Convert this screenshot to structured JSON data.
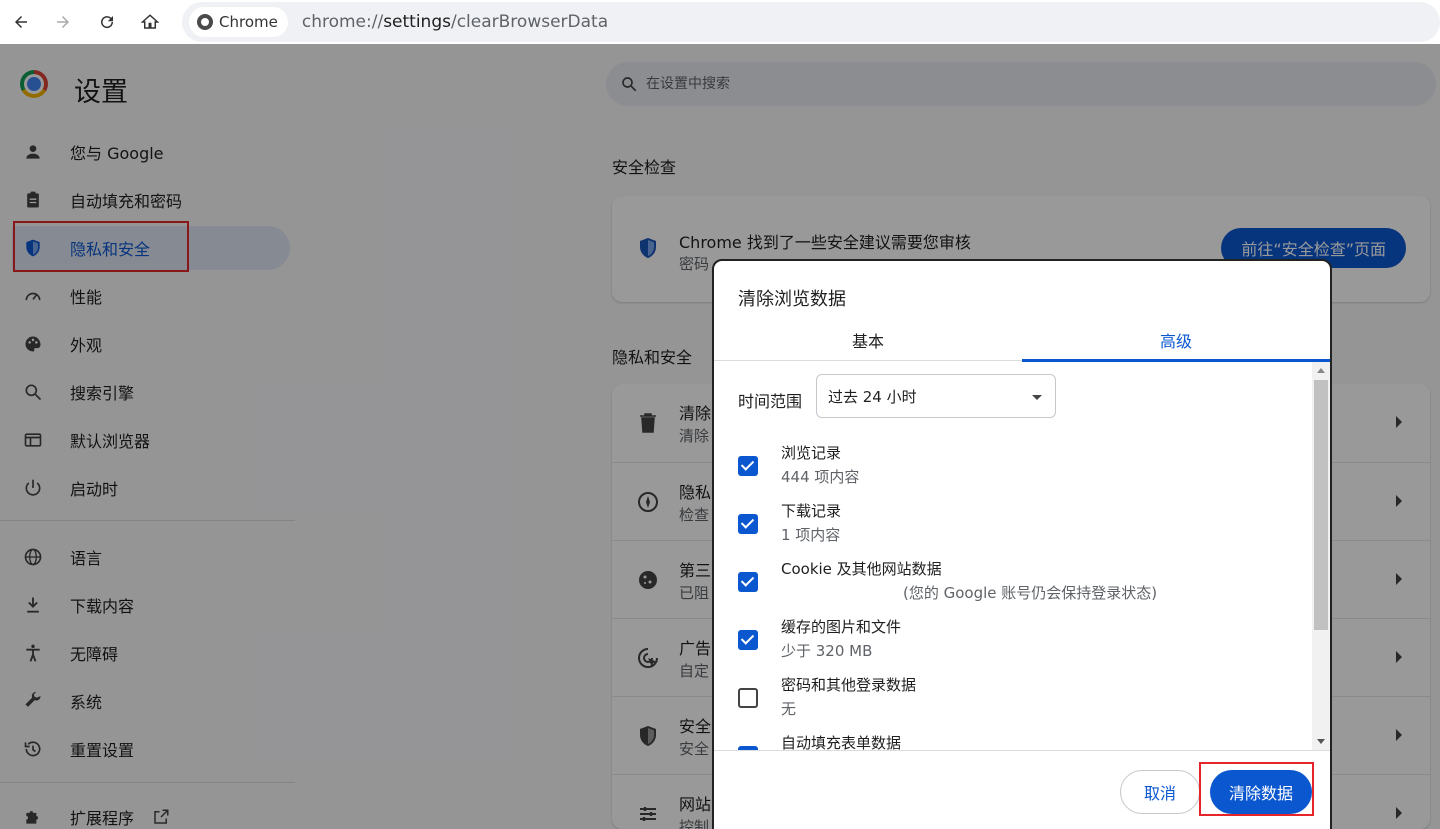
{
  "browser": {
    "chip_label": "Chrome",
    "url_scheme": "chrome://",
    "url_host": "settings",
    "url_path": "/clearBrowserData"
  },
  "settings": {
    "title": "设置",
    "search_placeholder": "在设置中搜索",
    "sidebar": [
      {
        "label": "您与 Google",
        "icon": "person-icon"
      },
      {
        "label": "自动填充和密码",
        "icon": "clipboard-icon"
      },
      {
        "label": "隐私和安全",
        "icon": "shield-icon",
        "active": true
      },
      {
        "label": "性能",
        "icon": "speedometer-icon"
      },
      {
        "label": "外观",
        "icon": "palette-icon"
      },
      {
        "label": "搜索引擎",
        "icon": "search-icon"
      },
      {
        "label": "默认浏览器",
        "icon": "browser-window-icon"
      },
      {
        "label": "启动时",
        "icon": "power-icon"
      },
      {
        "label": "语言",
        "icon": "globe-icon"
      },
      {
        "label": "下载内容",
        "icon": "download-icon"
      },
      {
        "label": "无障碍",
        "icon": "accessibility-icon"
      },
      {
        "label": "系统",
        "icon": "wrench-icon"
      },
      {
        "label": "重置设置",
        "icon": "history-icon"
      },
      {
        "label": "扩展程序",
        "icon": "puzzle-icon"
      }
    ],
    "safety_check": {
      "section_title": "安全检查",
      "message": "Chrome 找到了一些安全建议需要您审核",
      "sub": "密码",
      "button": "前往“安全检查”页面"
    },
    "privacy": {
      "section_title": "隐私和安全",
      "rows": [
        {
          "title": "清除",
          "sub": "清除"
        },
        {
          "title": "隐私",
          "sub": "检查"
        },
        {
          "title": "第三",
          "sub": "已阻"
        },
        {
          "title": "广告",
          "sub": "自定"
        },
        {
          "title": "安全",
          "sub": "安全"
        },
        {
          "title": "网站",
          "sub": "控制"
        }
      ]
    }
  },
  "dialog": {
    "title": "清除浏览数据",
    "tabs": [
      "基本",
      "高级"
    ],
    "selected_tab": "高级",
    "time_range_label": "时间范围",
    "time_range_value": "过去 24 小时",
    "options": [
      {
        "title": "浏览记录",
        "sub": "444 项内容",
        "checked": true
      },
      {
        "title": "下载记录",
        "sub": "1 项内容",
        "checked": true
      },
      {
        "title": "Cookie 及其他网站数据",
        "sub": "(您的 Google 账号仍会保持登录状态)",
        "checked": true
      },
      {
        "title": "缓存的图片和文件",
        "sub": "少于 320 MB",
        "checked": true
      },
      {
        "title": "密码和其他登录数据",
        "sub": "无",
        "checked": false
      },
      {
        "title": "自动填充表单数据",
        "sub": "",
        "checked": true
      }
    ],
    "cancel_label": "取消",
    "confirm_label": "清除数据"
  },
  "colors": {
    "accent": "#0b57d0",
    "highlight_box": "#e5252a"
  }
}
